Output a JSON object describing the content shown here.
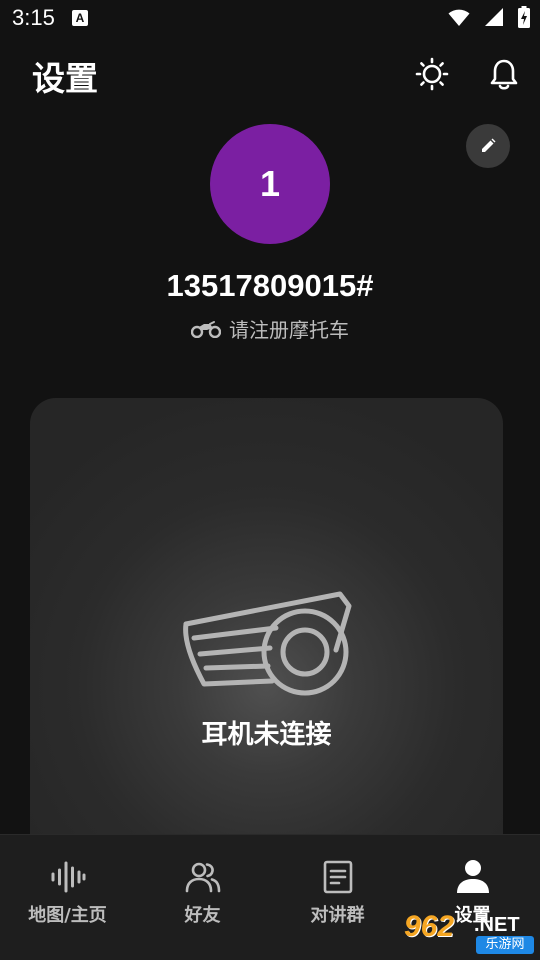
{
  "status_bar": {
    "time": "3:15",
    "notification_icon": "text-a-icon"
  },
  "header": {
    "title": "设置",
    "icons": [
      "brightness-icon",
      "bell-icon"
    ]
  },
  "profile": {
    "avatar_text": "1",
    "avatar_color": "#7b1fa2",
    "username": "13517809015#",
    "motorcycle_prompt": "请注册摩托车",
    "edit_icon": "pencil-icon"
  },
  "device": {
    "status": "耳机未连接",
    "icon": "intercom-headset-icon"
  },
  "bottom_nav": {
    "items": [
      {
        "label": "地图/主页",
        "icon": "audio-wave-icon",
        "active": false
      },
      {
        "label": "好友",
        "icon": "friends-icon",
        "active": false
      },
      {
        "label": "对讲群",
        "icon": "document-icon",
        "active": false
      },
      {
        "label": "设置",
        "icon": "person-icon",
        "active": true
      }
    ]
  },
  "watermark": {
    "number": "962",
    "suffix": ".NET",
    "sub": "乐游网"
  }
}
